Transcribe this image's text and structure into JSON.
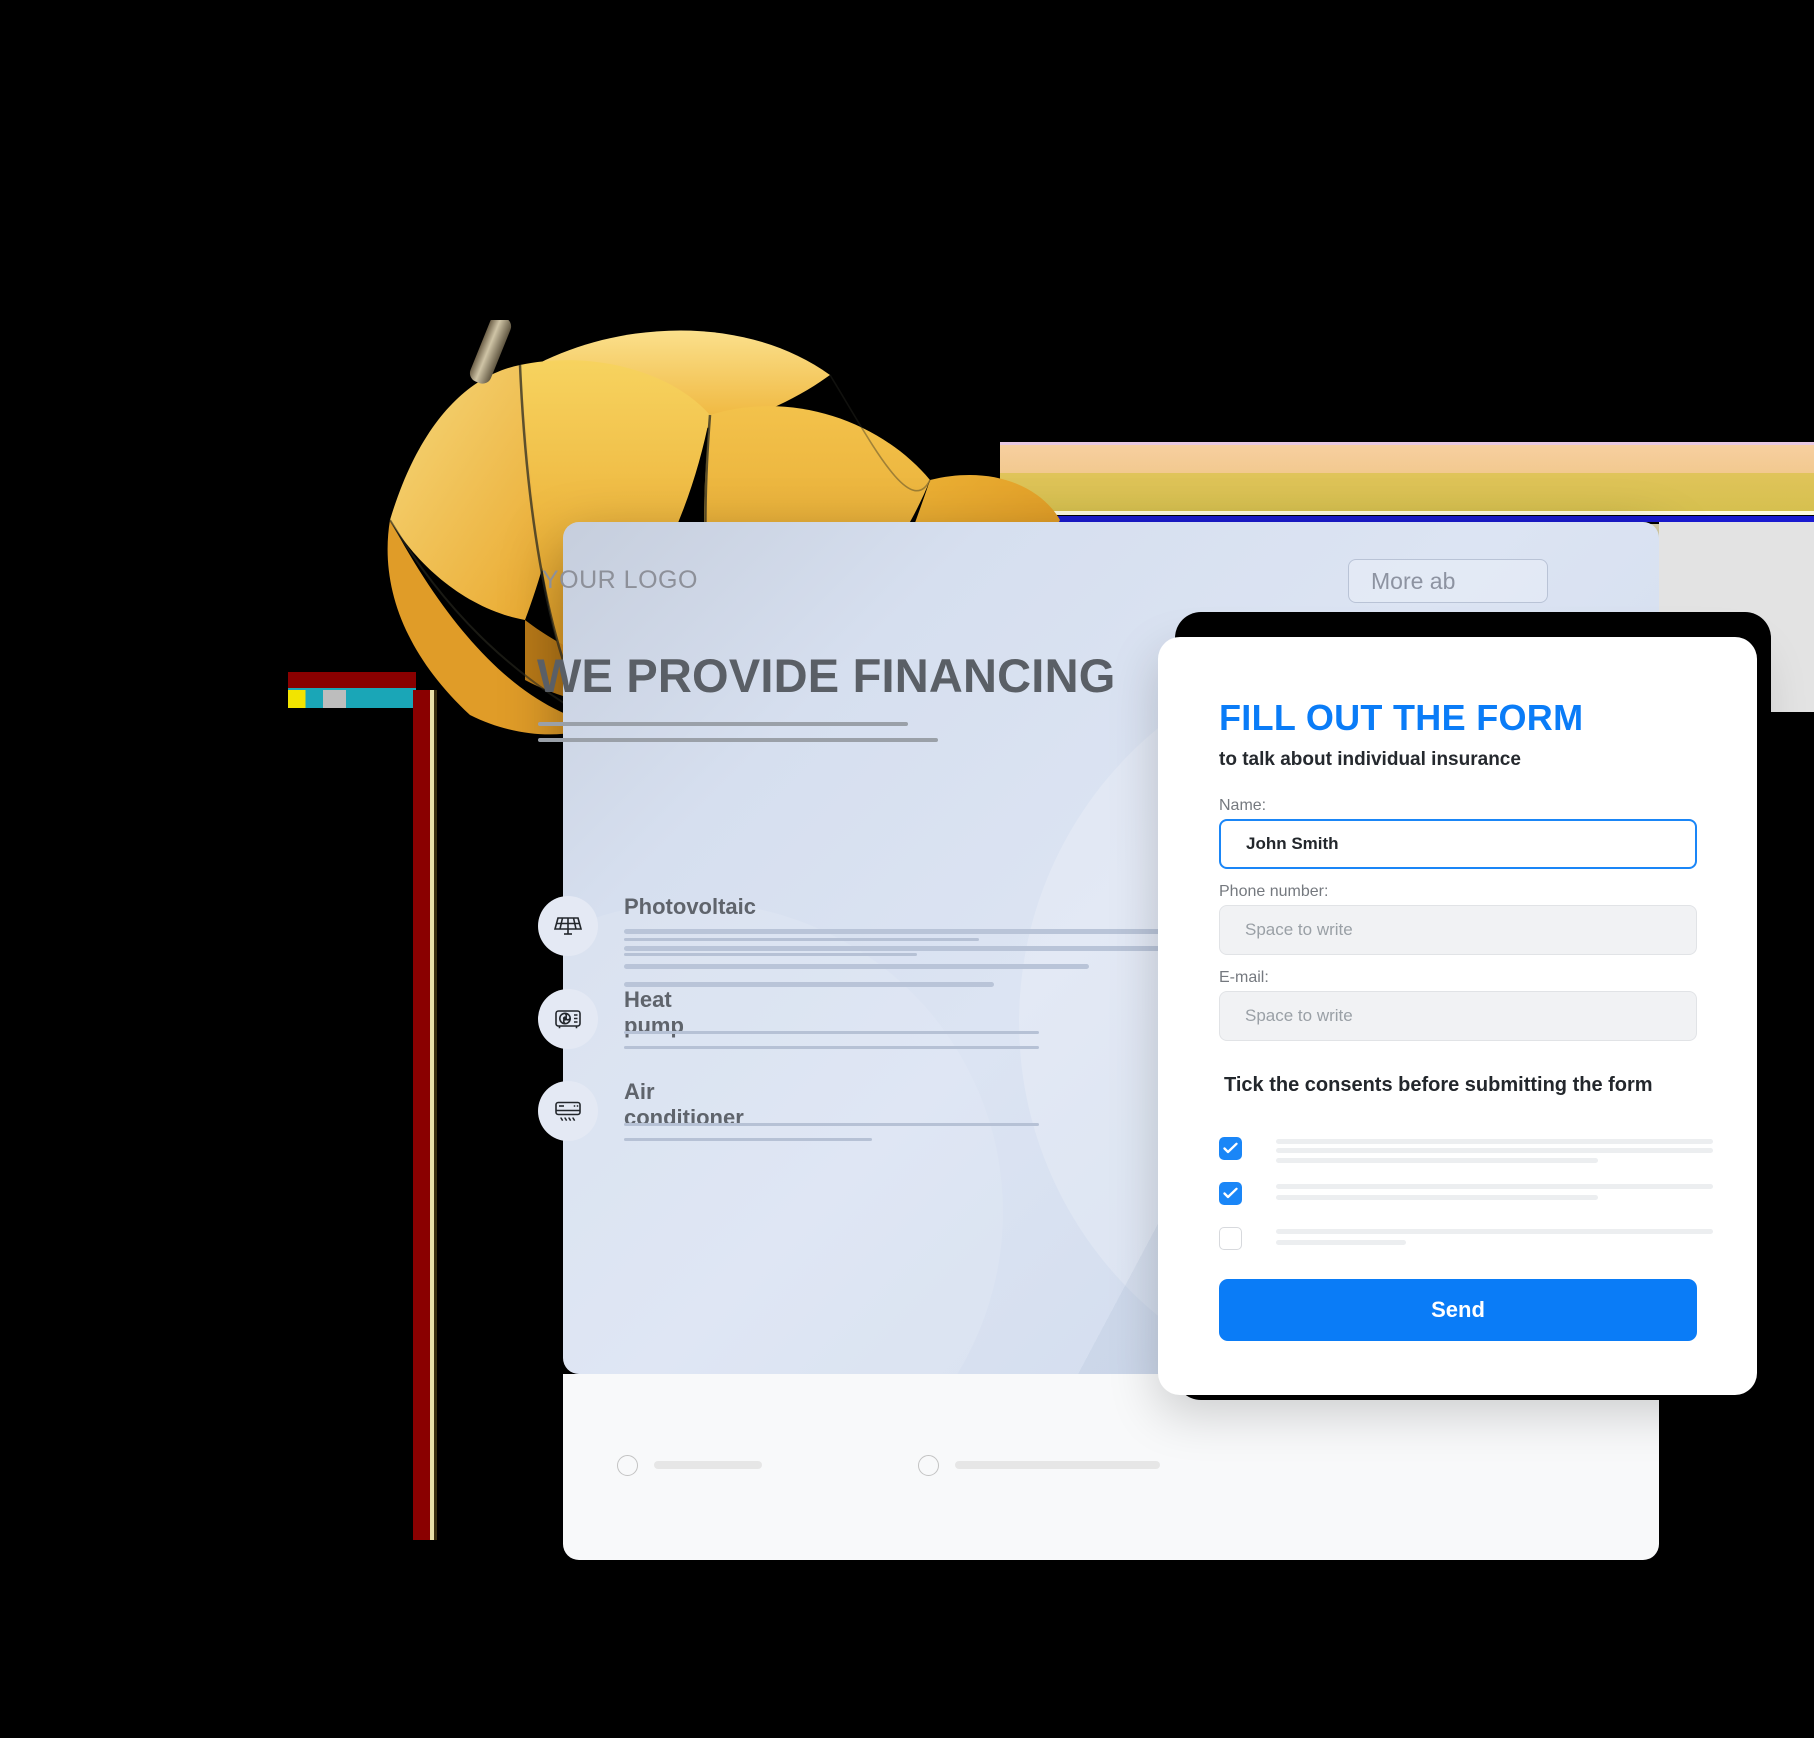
{
  "hero": {
    "logo": "YOUR LOGO",
    "more_button": "More ab",
    "title": "WE PROVIDE FINANCING",
    "services": [
      {
        "label": "Photovoltaic",
        "icon": "solar-panel-icon"
      },
      {
        "label": "Heat pump",
        "icon": "heat-pump-icon"
      },
      {
        "label": "Air conditioner",
        "icon": "air-conditioner-icon"
      }
    ]
  },
  "form": {
    "title": "FILL OUT THE FORM",
    "subtitle": "to talk about individual insurance",
    "fields": [
      {
        "label": "Name:",
        "value": "John Smith",
        "placeholder": "Space to write",
        "state": "filled"
      },
      {
        "label": "Phone number:",
        "value": "",
        "placeholder": "Space to write",
        "state": "empty"
      },
      {
        "label": "E-mail:",
        "value": "",
        "placeholder": "Space to write",
        "state": "empty"
      }
    ],
    "consents_title": "Tick the consents before submitting the form",
    "consents": [
      {
        "checked": true
      },
      {
        "checked": true
      },
      {
        "checked": false
      }
    ],
    "send_label": "Send"
  },
  "colors": {
    "accent_blue": "#0a7cf7",
    "checkbox_blue": "#1a86f7",
    "hero_blue": "#d6dfef",
    "umbrella_yellow": "#f0c03a",
    "shaft_red": "#8a0000"
  },
  "decor": {
    "umbrella": "yellow-umbrella",
    "grey_rect": "grey-rectangle-overlay",
    "streaks": "glitch-streak-artifact"
  }
}
